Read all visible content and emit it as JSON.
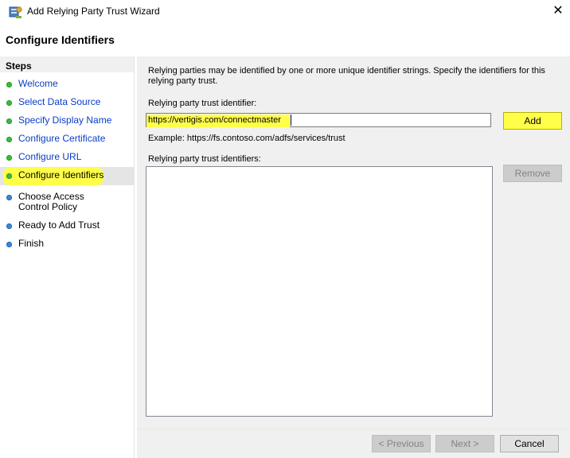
{
  "window": {
    "title": "Add Relying Party Trust Wizard",
    "close_glyph": "✕",
    "icon": "adfs-wizard-icon"
  },
  "header": {
    "title": "Configure Identifiers"
  },
  "steps": {
    "title": "Steps",
    "items": [
      {
        "label": "Welcome",
        "status": "complete"
      },
      {
        "label": "Select Data Source",
        "status": "complete"
      },
      {
        "label": "Specify Display Name",
        "status": "complete"
      },
      {
        "label": "Configure Certificate",
        "status": "complete"
      },
      {
        "label": "Configure URL",
        "status": "complete"
      },
      {
        "label": "Configure Identifiers",
        "status": "current"
      },
      {
        "label": "Choose Access Control Policy",
        "status": "pending"
      },
      {
        "label": "Ready to Add Trust",
        "status": "pending"
      },
      {
        "label": "Finish",
        "status": "pending"
      }
    ]
  },
  "main": {
    "description": "Relying parties may be identified by one or more unique identifier strings. Specify the identifiers for this relying party trust.",
    "identifier_label": "Relying party trust identifier:",
    "identifier_value": "https://vertigis.com/connectmaster",
    "add_label": "Add",
    "example": "Example: https://fs.contoso.com/adfs/services/trust",
    "identifiers_list_label": "Relying party trust identifiers:",
    "remove_label": "Remove"
  },
  "footer": {
    "previous_label": "< Previous",
    "next_label": "Next >",
    "cancel_label": "Cancel"
  },
  "colors": {
    "highlight": "#ffff4a",
    "link": "#0a3cc8",
    "complete_dot": "#3dbb3d",
    "pending_dot": "#3b87d9"
  }
}
